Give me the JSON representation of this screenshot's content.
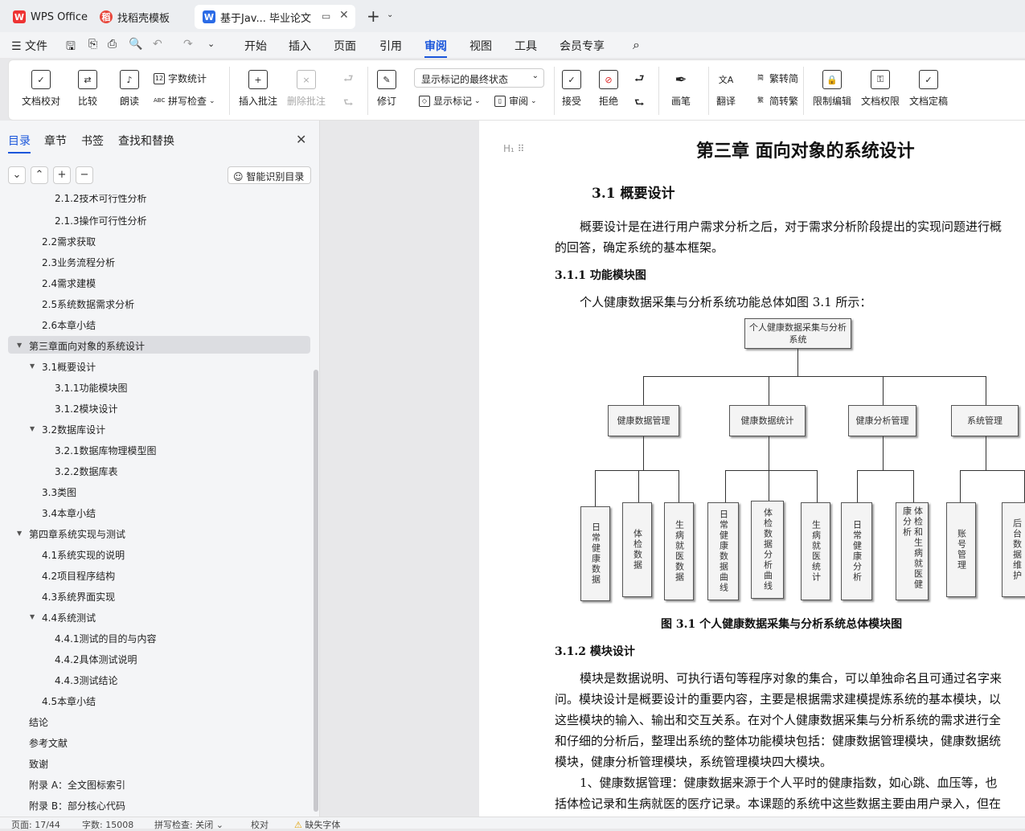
{
  "tabs": [
    {
      "label": "WPS Office",
      "icon": "wps-logo-icon"
    },
    {
      "label": "找稻壳模板",
      "icon": "docer-icon"
    },
    {
      "label": "基于Jav... 毕业论文",
      "icon": "word-doc-icon"
    }
  ],
  "menu": {
    "file": "文件",
    "items": [
      "开始",
      "插入",
      "页面",
      "引用",
      "审阅",
      "视图",
      "工具",
      "会员专享"
    ],
    "active": "审阅"
  },
  "ribbon": {
    "doc_check": "文档校对",
    "compare": "比较",
    "read_aloud": "朗读",
    "word_count": "字数统计",
    "spell_check": "拼写检查",
    "insert_comment": "插入批注",
    "delete_comment": "删除批注",
    "revise": "修订",
    "display_state": "显示标记的最终状态",
    "show_markup": "显示标记",
    "review_pane": "审阅",
    "accept": "接受",
    "reject": "拒绝",
    "pen": "画笔",
    "translate": "翻译",
    "trad_to_simp": "繁转简",
    "simp_to_trad": "简转繁",
    "restrict_edit": "限制编辑",
    "doc_permission": "文档权限",
    "doc_finalize": "文档定稿"
  },
  "sidebar": {
    "tabs": [
      "目录",
      "章节",
      "书签",
      "查找和替换"
    ],
    "smart_toc": "智能识别目录",
    "toc": [
      "2.1.2技术可行性分析",
      "2.1.3操作可行性分析",
      "2.2需求获取",
      "2.3业务流程分析",
      "2.4需求建模",
      "2.5系统数据需求分析",
      "2.6本章小结",
      "第三章面向对象的系统设计",
      "3.1概要设计",
      "3.1.1功能模块图",
      "3.1.2模块设计",
      "3.2数据库设计",
      "3.2.1数据库物理模型图",
      "3.2.2数据库表",
      "3.3类图",
      "3.4本章小结",
      "第四章系统实现与测试",
      "4.1系统实现的说明",
      "4.2项目程序结构",
      "4.3系统界面实现",
      "4.4系统测试",
      "4.4.1测试的目的与内容",
      "4.4.2具体测试说明",
      "4.4.3测试结论",
      "4.5本章小结",
      "结论",
      "参考文献",
      "致谢",
      "附录 A：全文图标索引",
      "附录 B：部分核心代码"
    ]
  },
  "doc": {
    "chapter_title": "第三章 面向对象的系统设计",
    "s31": "3.1  概要设计",
    "p1a": "概要设计是在进行用户需求分析之后，对于需求分析阶段提出的实现问题进行概",
    "p1b": "的回答，确定系统的基本框架。",
    "s311": "3.1.1  功能模块图",
    "p2": "个人健康数据采集与分析系统功能总体如图  3.1 所示：",
    "diagram": {
      "root": "个人健康数据采集与分析系统",
      "level1": [
        "健康数据管理",
        "健康数据统计",
        "健康分析管理",
        "系统管理"
      ],
      "leaves": [
        "日常健康数据",
        "体检数据",
        "生病就医数据",
        "日常健康数据曲线",
        "体检数据分析曲线",
        "生病就医统计",
        "日常健康分析",
        "体检和生病就医健康分析",
        "账号管理",
        "后台数据维护"
      ]
    },
    "fig_caption": "图  3.1 个人健康数据采集与分析系统总体模块图",
    "s312": "3.1.2  模块设计",
    "p3": [
      "模块是数据说明、可执行语句等程序对象的集合，可以单独命名且可通过名字来",
      "问。模块设计是概要设计的重要内容，主要是根据需求建模提炼系统的基本模块，以",
      "这些模块的输入、输出和交互关系。在对个人健康数据采集与分析系统的需求进行全",
      "和仔细的分析后，整理出系统的整体功能模块包括：健康数据管理模块，健康数据统",
      "模块，健康分析管理模块，系统管理模块四大模块。"
    ],
    "p4": [
      "1、健康数据管理：健康数据来源于个人平时的健康指数，如心跳、血压等，也",
      "括体检记录和生病就医的医疗记录。本课题的系统中这些数据主要由用户录入，但在"
    ]
  },
  "status": {
    "page": "页面: 17/44",
    "words": "字数: 15008",
    "spell": "拼写检查: 关闭",
    "proof": "校对",
    "missing_font": "缺失字体"
  }
}
